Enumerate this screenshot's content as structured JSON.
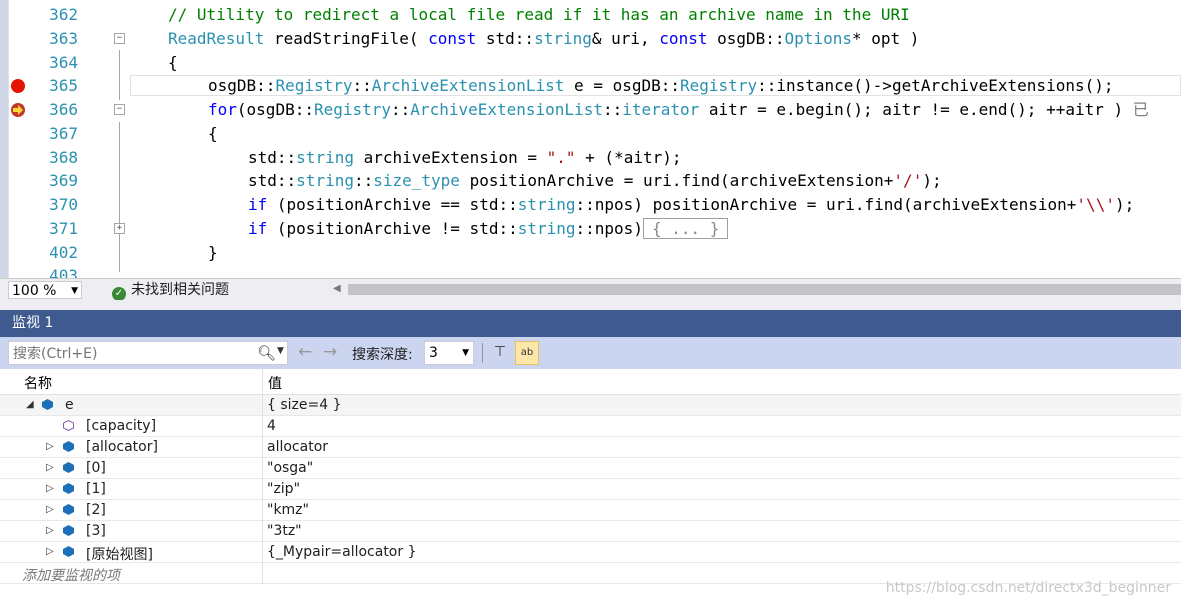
{
  "editor": {
    "line_numbers": [
      "362",
      "363",
      "364",
      "365",
      "366",
      "367",
      "368",
      "369",
      "370",
      "371",
      "402",
      "403"
    ],
    "lines": {
      "l362": "// Utility to redirect a local file read if it has an archive name in the URI",
      "l363": {
        "p1": "ReadResult",
        "p2": " readStringFile( ",
        "p3": "const",
        "p4": " std::",
        "p5": "string",
        "p6": "& uri, ",
        "p7": "const",
        "p8": " osgDB::",
        "p9": "Options",
        "p10": "* opt )"
      },
      "l364": "{",
      "l365": {
        "p1": "osgDB::",
        "p2": "Registry",
        "p3": "::",
        "p4": "ArchiveExtensionList",
        "p5": " e = osgDB::",
        "p6": "Registry",
        "p7": "::instance()->getArchiveExtensions();"
      },
      "l366": {
        "p1": "for",
        "p2": "(osgDB::",
        "p3": "Registry",
        "p4": "::",
        "p5": "ArchiveExtensionList",
        "p6": "::",
        "p7": "iterator",
        "p8": " aitr = e.begin(); aitr != e.end(); ++aitr ) ",
        "p9": "已"
      },
      "l367": "{",
      "l368": {
        "p1": "std::",
        "p2": "string",
        "p3": " archiveExtension = ",
        "p4": "\".\"",
        "p5": " + (*aitr);"
      },
      "l369": {
        "p1": "std::",
        "p2": "string",
        "p3": "::",
        "p4": "size_type",
        "p5": " positionArchive = uri.find(archiveExtension+",
        "p6": "'/'",
        "p7": ");"
      },
      "l370": {
        "p1": "if",
        "p2": " (positionArchive == std::",
        "p3": "string",
        "p4": "::npos) positionArchive = uri.find(archiveExtension+",
        "p5": "'\\\\'",
        "p6": ");"
      },
      "l371": {
        "p1": "if",
        "p2": " (positionArchive != std::",
        "p3": "string",
        "p4": "::npos)",
        "p5": "{ ... }"
      },
      "l402": "}"
    }
  },
  "statusbar": {
    "zoom": "100 %",
    "issues": "未找到相关问题"
  },
  "watch": {
    "title": "监视 1",
    "search_placeholder": "搜索(Ctrl+E)",
    "depth_label": "搜索深度:",
    "depth_value": "3",
    "columns": {
      "name": "名称",
      "value": "值"
    },
    "rows": [
      {
        "name": "e",
        "value": "{ size=4 }"
      },
      {
        "name": "[capacity]",
        "value": "4"
      },
      {
        "name": "[allocator]",
        "value": "allocator"
      },
      {
        "name": "[0]",
        "value": "\"osga\""
      },
      {
        "name": "[1]",
        "value": "\"zip\""
      },
      {
        "name": "[2]",
        "value": "\"kmz\""
      },
      {
        "name": "[3]",
        "value": "\"3tz\""
      },
      {
        "name": "[原始视图]",
        "value": "{_Mypair=allocator }"
      }
    ],
    "add_item_placeholder": "添加要监视的项"
  },
  "watermark": "https://blog.csdn.net/directx3d_beginner",
  "colors": {
    "title_bar": "#3f5a8f",
    "toolbar": "#ccd5f0",
    "keyword": "#0000ff",
    "type": "#2b91af",
    "comment": "#008000",
    "string": "#a31515"
  }
}
